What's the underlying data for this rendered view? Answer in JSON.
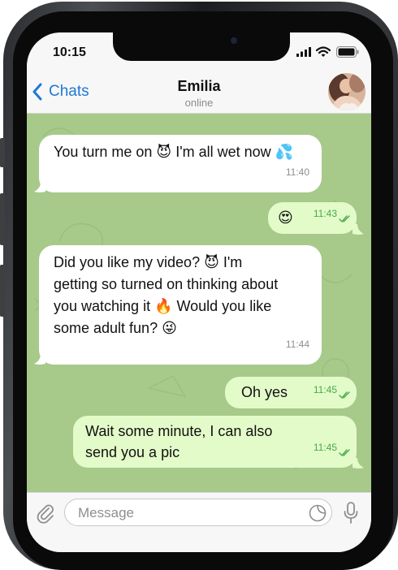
{
  "status_bar": {
    "time": "10:15"
  },
  "header": {
    "back_label": "Chats",
    "contact_name": "Emilia",
    "contact_status": "online"
  },
  "messages": [
    {
      "direction": "incoming",
      "text": "You turn me on 😈 I'm all wet now 💦",
      "time": "11:40"
    },
    {
      "direction": "outgoing",
      "text": "😍",
      "time": "11:43",
      "read": true
    },
    {
      "direction": "incoming",
      "text": "Did you like my video? 😈 I'm getting so turned on thinking about you watching it 🔥 Would you like some adult fun? 😜",
      "time": "11:44"
    },
    {
      "direction": "outgoing",
      "text": "Oh yes",
      "time": "11:45",
      "read": true
    },
    {
      "direction": "outgoing",
      "text": "Wait some minute, I can also send you a pic",
      "time": "11:45",
      "read": true
    }
  ],
  "composer": {
    "placeholder": "Message",
    "value": ""
  },
  "colors": {
    "chat_background": "#a7c98a",
    "incoming_bubble": "#ffffff",
    "outgoing_bubble": "#e3fbc9",
    "accent": "#1e78d6",
    "outgoing_time": "#4aa84a"
  },
  "icons": [
    "chevron-left-icon",
    "attach-icon",
    "sticker-icon",
    "mic-icon",
    "double-check-icon",
    "signal-icon",
    "wifi-icon",
    "battery-icon"
  ]
}
